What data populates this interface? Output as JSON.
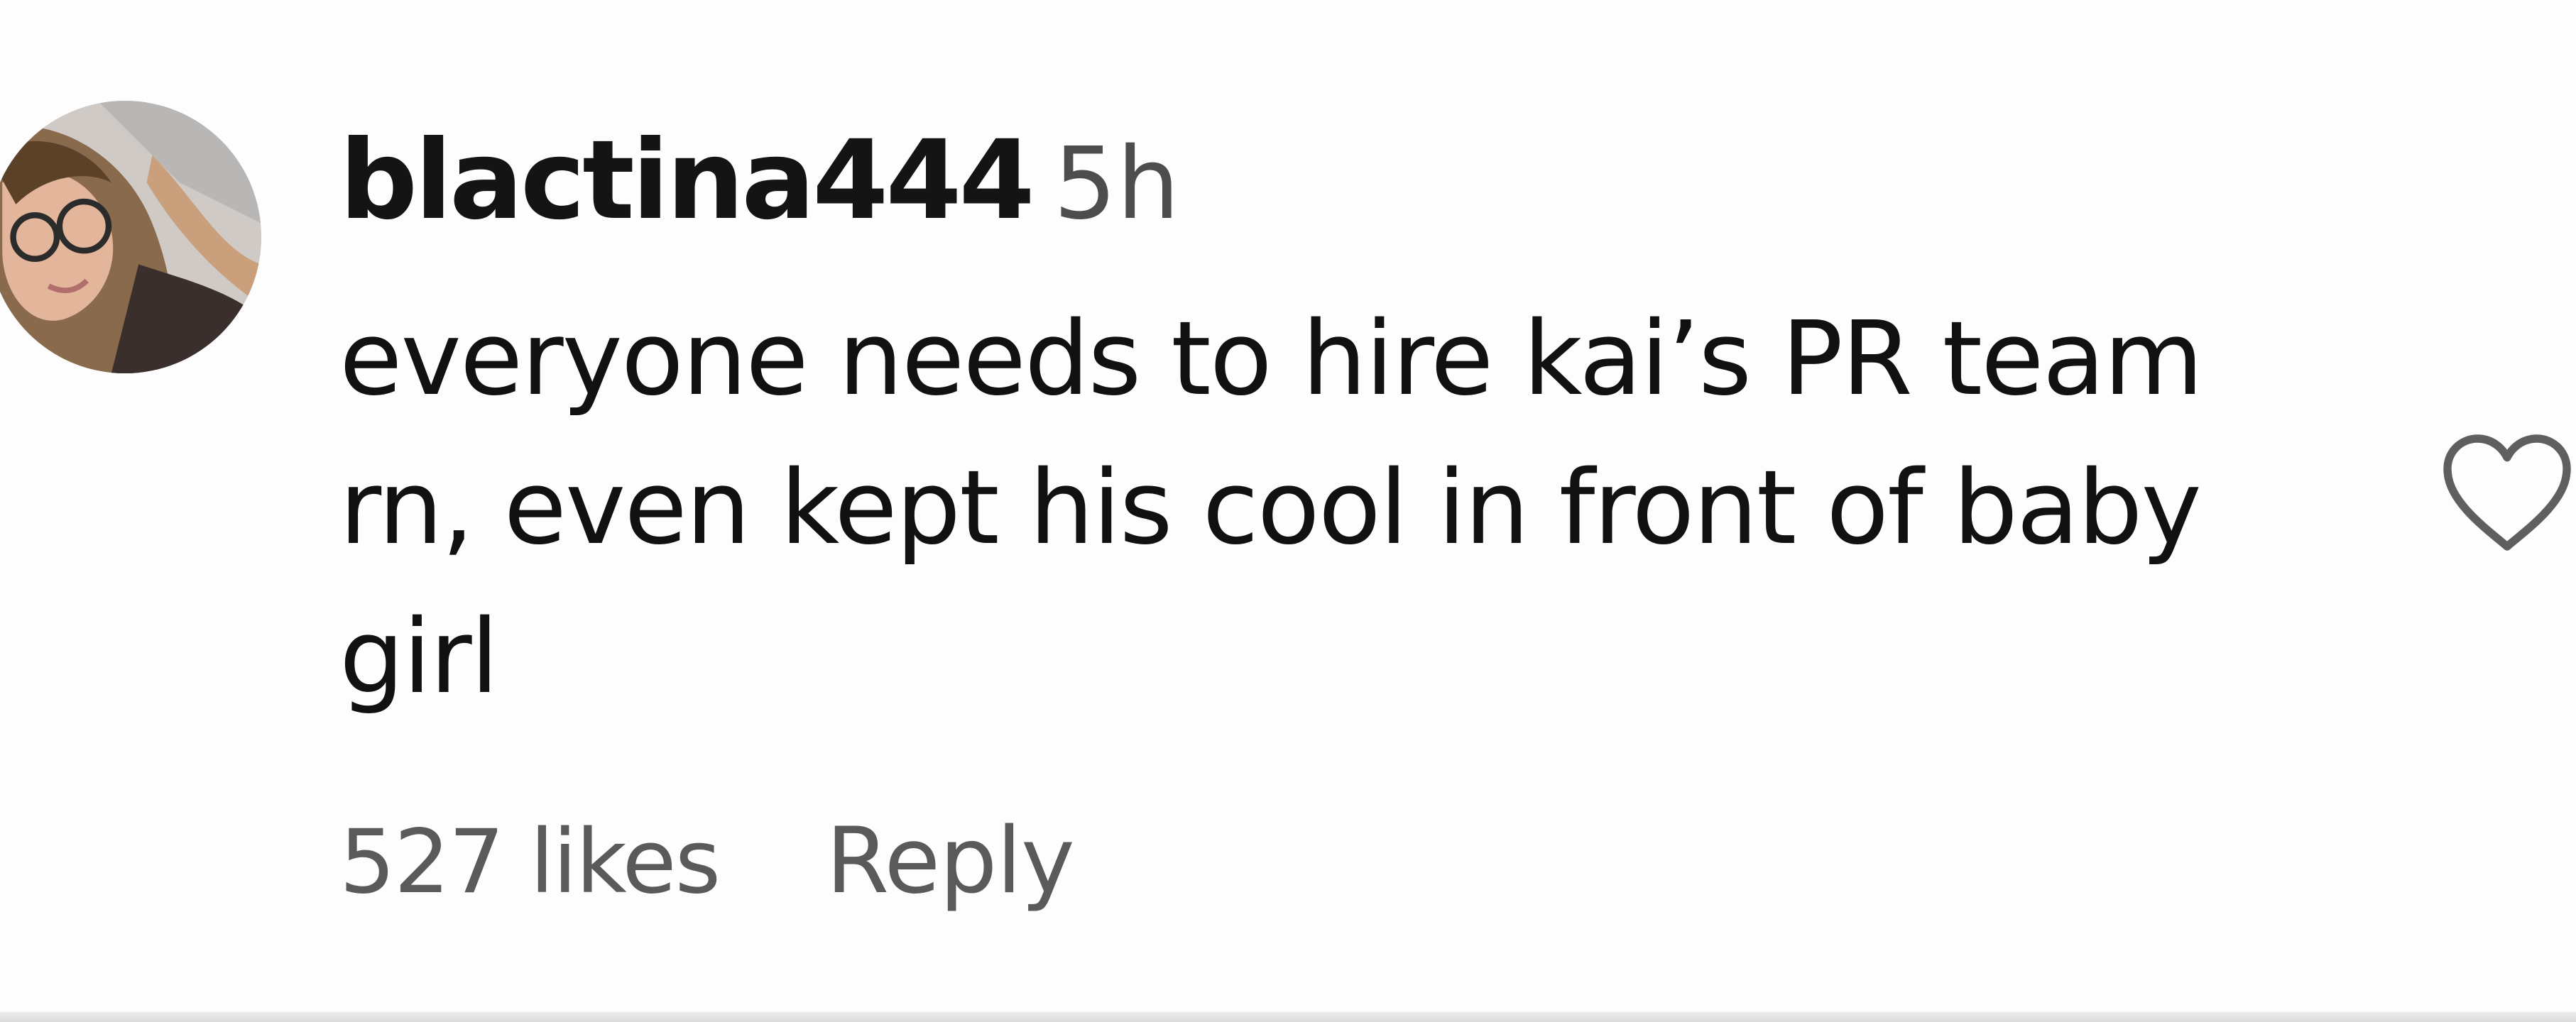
{
  "comment": {
    "username": "blactina444",
    "timestamp": "5h",
    "text": "everyone needs to hire kai’s PR team rn, even kept his cool in front of baby girl",
    "likes_label": "527 likes",
    "reply_label": "Reply",
    "avatar_icon": "profile-photo",
    "like_icon": "heart-outline-icon"
  }
}
